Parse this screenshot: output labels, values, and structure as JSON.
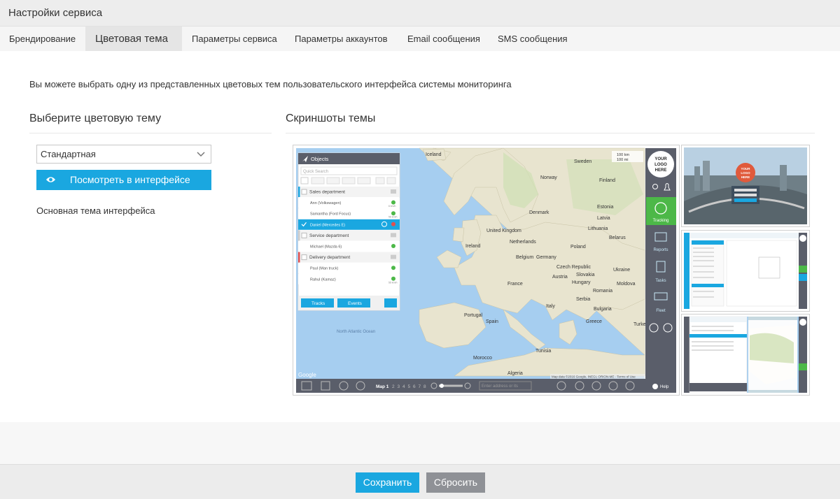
{
  "window": {
    "title": "Настройки сервиса"
  },
  "tabs": [
    {
      "label": "Брендирование",
      "active": false
    },
    {
      "label": "Цветовая тема",
      "active": true
    },
    {
      "label": "Параметры сервиса",
      "active": false
    },
    {
      "label": "Параметры аккаунтов",
      "active": false
    },
    {
      "label": "Email сообщения",
      "active": false
    },
    {
      "label": "SMS сообщения",
      "active": false
    }
  ],
  "intro_text": "Вы можете выбрать одну из представленных цветовых тем пользовательского интерфейса системы мониторинга",
  "left_panel": {
    "heading": "Выберите цветовую тему",
    "theme_select": {
      "value": "Стандартная"
    },
    "view_button": "Посмотреть в интерфейсе",
    "theme_description": "Основная тема интерфейса"
  },
  "right_panel": {
    "heading": "Скриншоты темы",
    "preview": {
      "objects_panel": {
        "title": "Objects",
        "search_placeholder": "Quick Search",
        "rows": [
          {
            "type": "group",
            "label": "Sales department",
            "color": "#1aa7e0"
          },
          {
            "type": "item",
            "label": "Ann (Volkswagen)",
            "speed": "6 km/h"
          },
          {
            "type": "item",
            "label": "Samantha (Ford Focus)",
            "speed": "56 km/h"
          },
          {
            "type": "item-selected",
            "label": "Daniel (Mercedes E)",
            "speed": ""
          },
          {
            "type": "group",
            "label": "Service department",
            "color": "#cccccc"
          },
          {
            "type": "item",
            "label": "Michael (Mazda 6)",
            "speed": ""
          },
          {
            "type": "group",
            "label": "Delivery department",
            "color": "#e05050"
          },
          {
            "type": "item",
            "label": "Paul (Man truck)",
            "speed": ""
          },
          {
            "type": "item",
            "label": "Rahul (Kamaz)",
            "speed": "55 km/h"
          }
        ],
        "tracks_label": "Tracks",
        "events_label": "Events"
      },
      "sidebar": {
        "logo_lines": [
          "YOUR",
          "LOGO",
          "HERE"
        ],
        "items": [
          "Tracking",
          "Reports",
          "Tasks",
          "Fleet"
        ],
        "help": "Help"
      },
      "map_labels": [
        "Iceland",
        "Norway",
        "Sweden",
        "Finland",
        "Estonia",
        "Latvia",
        "Lithuania",
        "Belarus",
        "Denmark",
        "United Kingdom",
        "Ireland",
        "Netherlands",
        "Poland",
        "Germany",
        "Belgium",
        "Czech Republic",
        "Ukraine",
        "Slovakia",
        "Austria",
        "Hungary",
        "Moldova",
        "France",
        "Romania",
        "Serbia",
        "Bulgaria",
        "Italy",
        "Portugal",
        "Spain",
        "Greece",
        "Turkey",
        "Morocco",
        "Algeria",
        "Tunisia",
        "North Atlantic Ocean",
        "Google"
      ],
      "scale": [
        "100 km",
        "100 mi"
      ],
      "bottom_bar": {
        "map_label": "Map 1",
        "pages": [
          "2",
          "3",
          "4",
          "5",
          "6",
          "7",
          "8"
        ],
        "search_placeholder": "Enter address or its"
      },
      "attribution": "Map data ©2016 Google, INEGI, ORION-ME · Terms of Use"
    },
    "thumbnail_logo": [
      "YOUR",
      "LOGO",
      "HERE"
    ]
  },
  "footer": {
    "save": "Сохранить",
    "reset": "Сбросить"
  },
  "colors": {
    "accent": "#1aa7e0",
    "green": "#4cb848",
    "sidebar": "#5a5e6a",
    "reset": "#8f9196"
  }
}
